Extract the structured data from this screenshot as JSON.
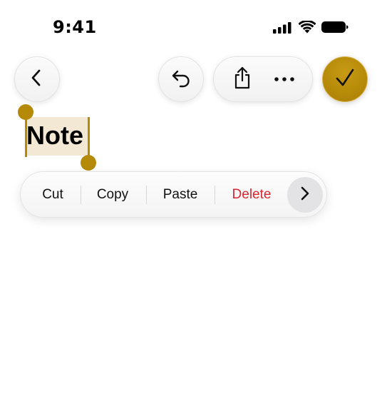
{
  "status_bar": {
    "time": "9:41",
    "icons": [
      "signal-icon",
      "wifi-icon",
      "battery-icon"
    ]
  },
  "toolbar": {
    "back_icon": "chevron-left-icon",
    "undo_icon": "undo-icon",
    "share_icon": "share-icon",
    "more_icon": "ellipsis-icon",
    "done_icon": "checkmark-icon"
  },
  "note": {
    "title": "Note",
    "selected": true
  },
  "edit_menu": {
    "items": [
      {
        "label": "Cut"
      },
      {
        "label": "Copy"
      },
      {
        "label": "Paste"
      },
      {
        "label": "Delete",
        "destructive": true
      }
    ],
    "more_icon": "chevron-right-icon"
  },
  "colors": {
    "accent": "#b58a08",
    "selection_highlight": "#f2e8d3",
    "destructive": "#d9262f",
    "glass": "#f4f4f4"
  }
}
